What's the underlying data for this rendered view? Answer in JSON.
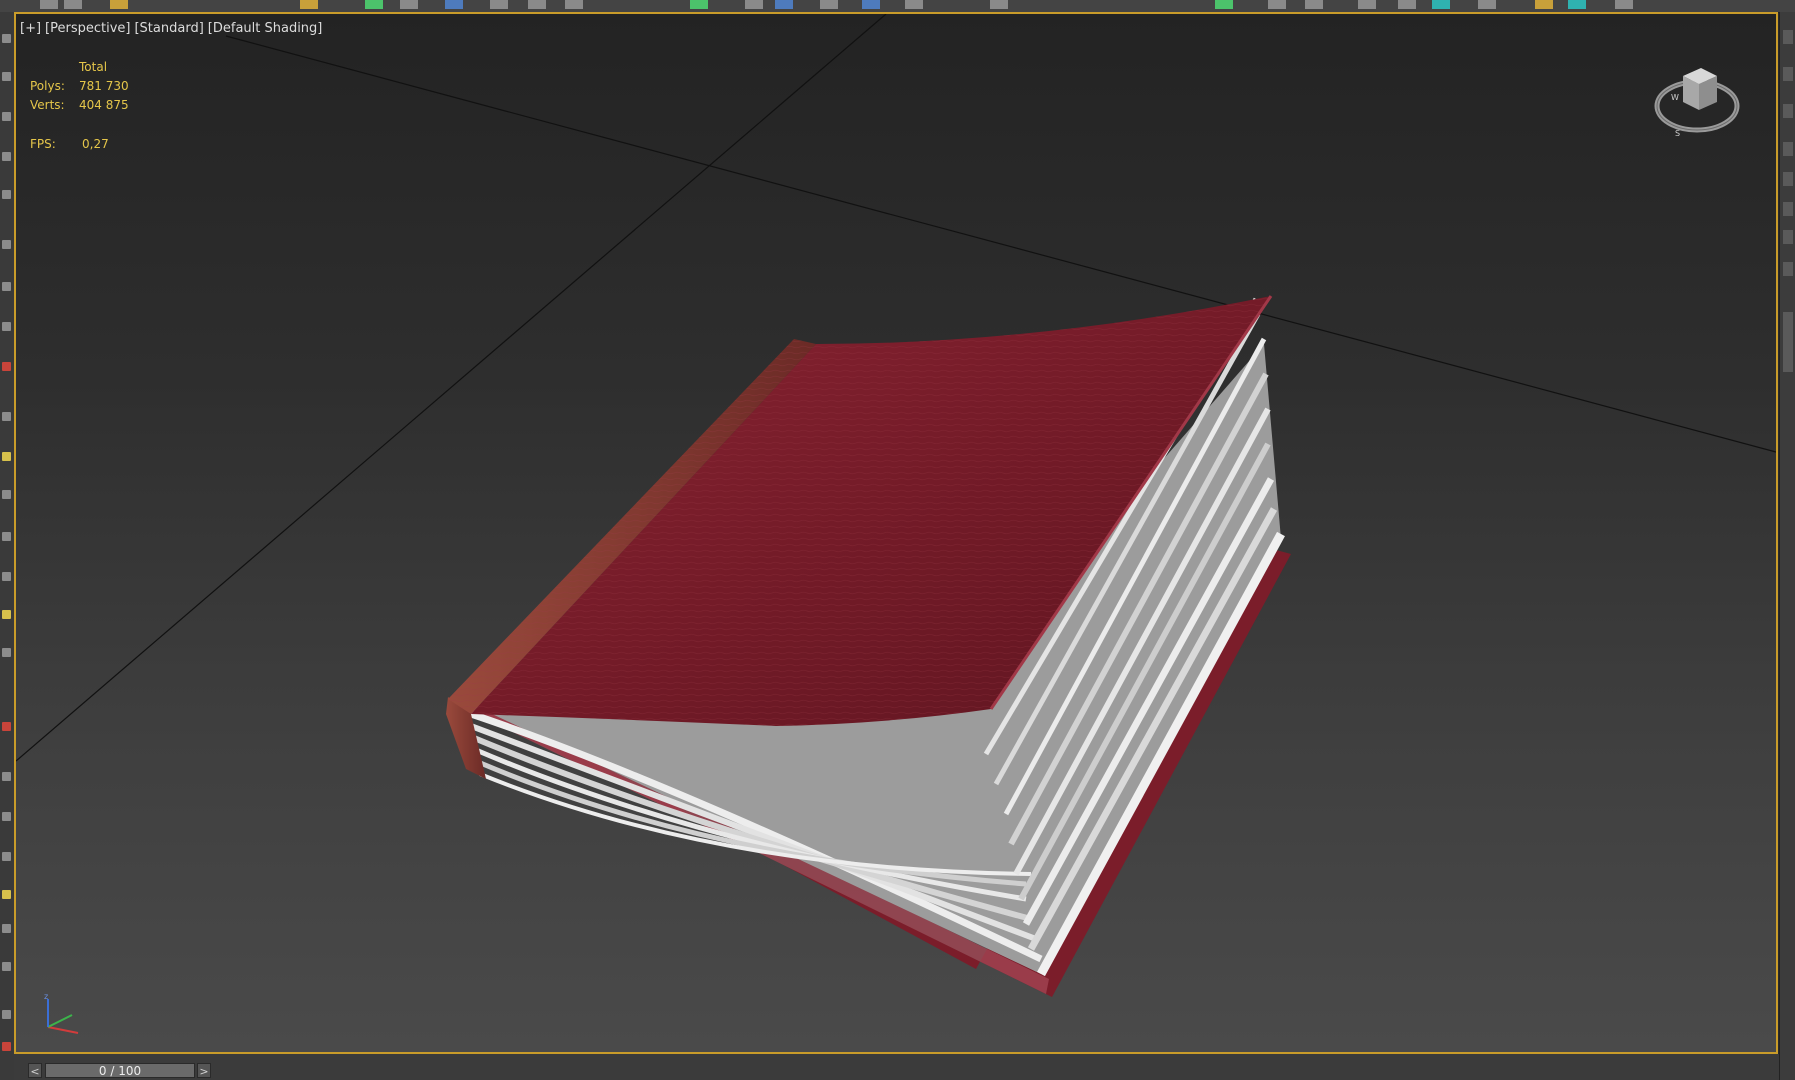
{
  "viewport": {
    "labels": [
      "[+]",
      "[Perspective]",
      "[Standard]",
      "[Default Shading]"
    ]
  },
  "stats": {
    "header": "Total",
    "polys_label": "Polys:",
    "polys_value": "781 730",
    "verts_label": "Verts:",
    "verts_value": "404 875",
    "fps_label": "FPS:",
    "fps_value": "0,27"
  },
  "timeline": {
    "prev": "<",
    "next": ">",
    "frame": "0 / 100"
  },
  "colors": {
    "viewport_border": "#c99c2a",
    "stats_text": "#e5c64a",
    "book_cover": "#7a1e2b"
  }
}
